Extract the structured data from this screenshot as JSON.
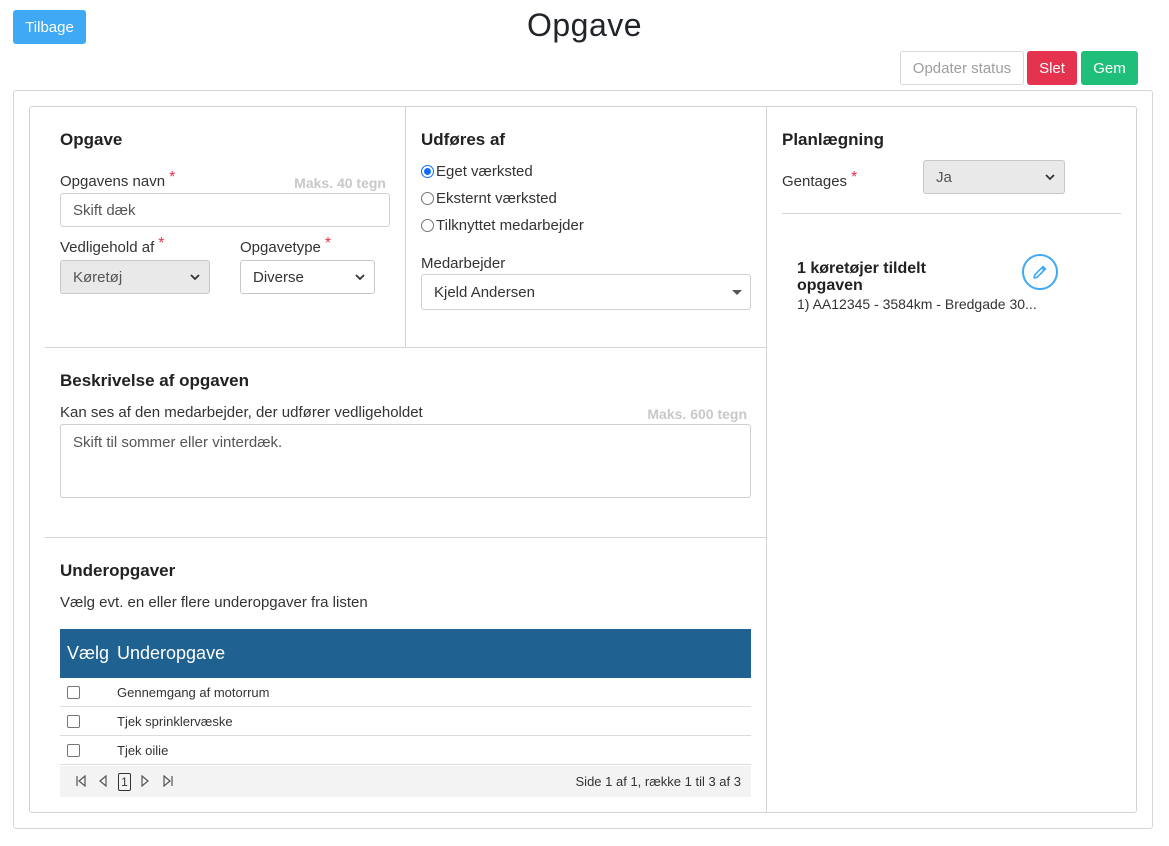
{
  "header": {
    "title": "Opgave",
    "back_label": "Tilbage",
    "update_status_label": "Opdater status",
    "delete_label": "Slet",
    "save_label": "Gem"
  },
  "task": {
    "heading": "Opgave",
    "name_label": "Opgavens navn",
    "name_max": "Maks. 40 tegn",
    "name_value": "Skift dæk",
    "maintenance_label": "Vedligehold af",
    "maintenance_value": "Køretøj",
    "type_label": "Opgavetype",
    "type_value": "Diverse",
    "required_mark": "*"
  },
  "performed_by": {
    "heading": "Udføres af",
    "options": [
      "Eget værksted",
      "Eksternt værksted",
      "Tilknyttet medarbejder"
    ],
    "selected": "Eget værksted",
    "employee_label": "Medarbejder",
    "employee_value": "Kjeld Andersen"
  },
  "planning": {
    "heading": "Planlægning",
    "repeat_label": "Gentages",
    "repeat_value": "Ja",
    "vehicles_title": "1 køretøjer tildelt opgaven",
    "vehicles_line": "1) AA12345 - 3584km - Bredgade 30..."
  },
  "description": {
    "heading": "Beskrivelse af opgaven",
    "sublabel": "Kan ses af den medarbejder, der udfører vedligeholdet",
    "max": "Maks. 600 tegn",
    "value": "Skift til sommer eller vinterdæk."
  },
  "subtasks": {
    "heading": "Underopgaver",
    "sublabel": "Vælg evt. en eller flere underopgaver fra listen",
    "columns": [
      "Vælg",
      "Underopgave"
    ],
    "rows": [
      "Gennemgang af motorrum",
      "Tjek sprinklervæske",
      "Tjek oilie"
    ],
    "page_number": "1",
    "pager_info": "Side 1 af 1, række 1 til 3 af 3"
  },
  "colors": {
    "primary": "#3fa9f5",
    "danger": "#e5334f",
    "success": "#1fbf7a",
    "table_header": "#1f6190"
  },
  "icons": {
    "edit": "pencil-icon",
    "select": "chevron-down-icon",
    "pager_first": "first-page-icon",
    "pager_prev": "prev-page-icon",
    "pager_next": "next-page-icon",
    "pager_last": "last-page-icon"
  }
}
